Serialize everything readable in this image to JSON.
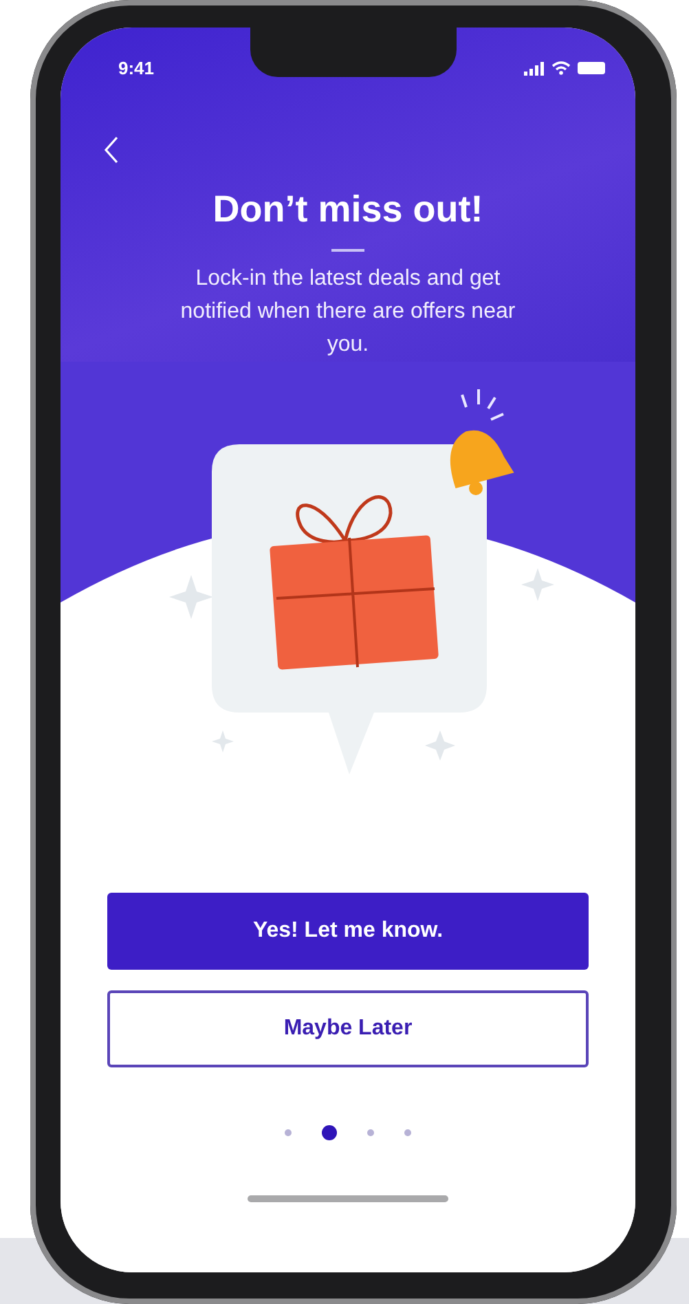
{
  "status_bar": {
    "time": "9:41"
  },
  "header": {
    "title": "Don’t miss out!",
    "message": "Lock-in the latest deals and get notified when there are offers near you."
  },
  "actions": [
    {
      "label": "Yes! Let me know.",
      "kind": "primary"
    },
    {
      "label": "Maybe Later",
      "kind": "secondary"
    }
  ],
  "pager": [
    {
      "selected": false
    },
    {
      "selected": true
    },
    {
      "selected": false
    },
    {
      "selected": false
    }
  ]
}
